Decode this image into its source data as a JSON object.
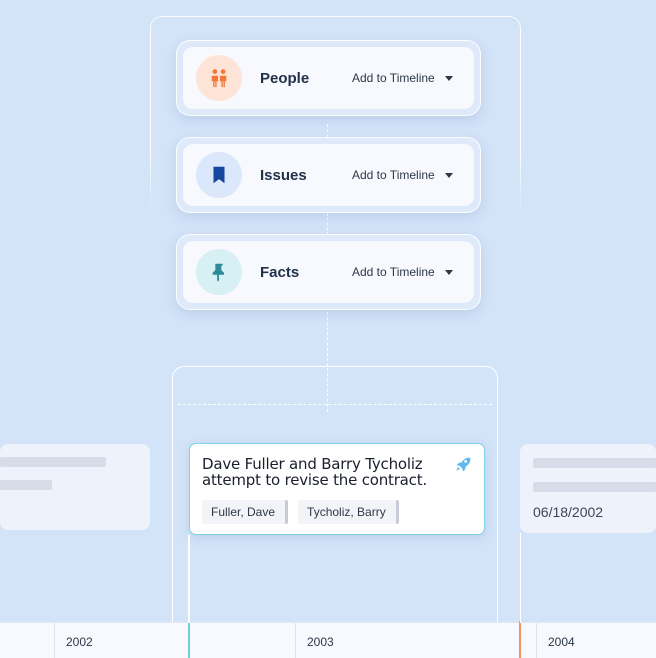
{
  "categories": [
    {
      "label": "People",
      "action": "Add to Timeline",
      "icon": "people-icon",
      "icon_color": "#f2783a",
      "icon_bg": "#fde4d6"
    },
    {
      "label": "Issues",
      "action": "Add to Timeline",
      "icon": "bookmark-icon",
      "icon_color": "#17469e",
      "icon_bg": "#dbe7fb"
    },
    {
      "label": "Facts",
      "action": "Add to Timeline",
      "icon": "pin-icon",
      "icon_color": "#2d8a98",
      "icon_bg": "#d6f0f3"
    }
  ],
  "event": {
    "title": "Dave Fuller and Barry Tycholiz attempt to revise the contract.",
    "icon": "rocket-icon",
    "people": [
      "Fuller, Dave",
      "Tycholiz, Barry"
    ],
    "accent": "#7fd2df"
  },
  "right_card": {
    "date": "06/18/2002"
  },
  "timeline": {
    "years": [
      "2002",
      "2003",
      "2004"
    ],
    "marker_colors": [
      "#6ccfdc",
      "#f0916a"
    ]
  }
}
